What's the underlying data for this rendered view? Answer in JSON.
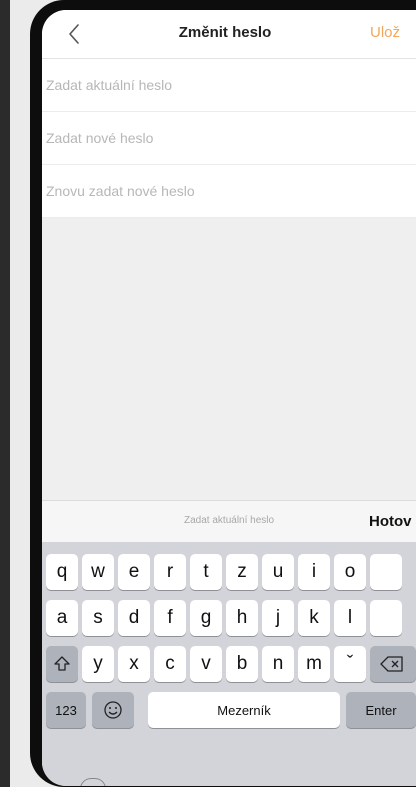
{
  "nav": {
    "title": "Změnit heslo",
    "save_label": "Ulož"
  },
  "form": {
    "current_placeholder": "Zadat aktuální heslo",
    "new_placeholder": "Zadat nové heslo",
    "confirm_placeholder": "Znovu zadat nové heslo"
  },
  "accessory": {
    "hint": "Zadat aktuální heslo",
    "done_label": "Hotov"
  },
  "keyboard": {
    "row1": [
      "q",
      "w",
      "e",
      "r",
      "t",
      "z",
      "u",
      "i",
      "o"
    ],
    "row2": [
      "a",
      "s",
      "d",
      "f",
      "g",
      "h",
      "j",
      "k",
      "l"
    ],
    "row3": [
      "y",
      "x",
      "c",
      "v",
      "b",
      "n",
      "m",
      "ˇ"
    ],
    "numbers_label": "123",
    "space_label": "Mezerník",
    "enter_label": "Enter",
    "icons": {
      "shift": "shift-icon",
      "emoji": "emoji-icon",
      "backspace": "backspace-icon"
    }
  },
  "colors": {
    "accent": "#f0a95a",
    "keyboard_bg": "#d2d4d9"
  }
}
